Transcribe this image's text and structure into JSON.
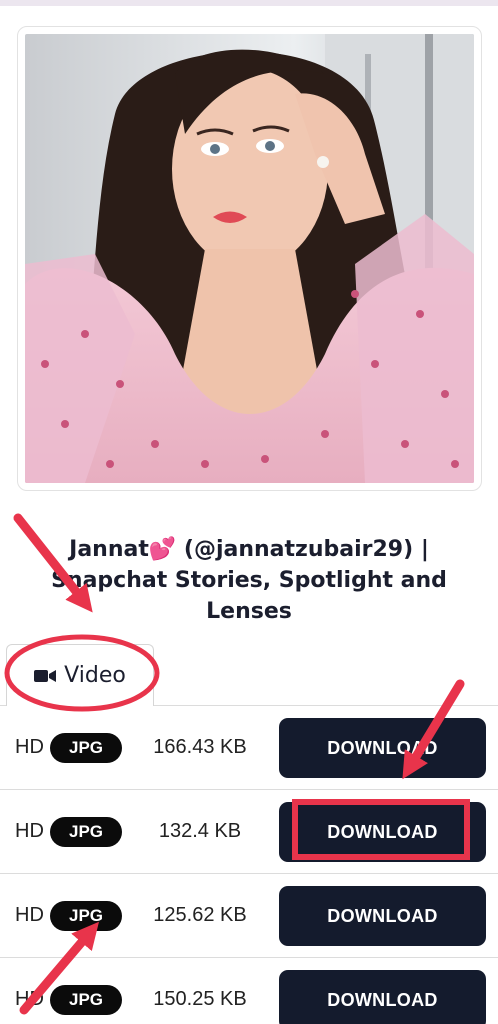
{
  "profile": {
    "title": "Jannat💕 (@jannatzubair29) | Snapchat Stories, Spotlight and Lenses",
    "photo_alt": "profile photo"
  },
  "tabs": [
    {
      "label": "Video",
      "icon": "video-camera-icon"
    }
  ],
  "downloads": [
    {
      "quality": "HD",
      "format": "JPG",
      "size": "166.43 KB",
      "button": "DOWNLOAD"
    },
    {
      "quality": "HD",
      "format": "JPG",
      "size": "132.4 KB",
      "button": "DOWNLOAD"
    },
    {
      "quality": "HD",
      "format": "JPG",
      "size": "125.62 KB",
      "button": "DOWNLOAD"
    },
    {
      "quality": "HD",
      "format": "JPG",
      "size": "150.25 KB",
      "button": "DOWNLOAD"
    }
  ],
  "colors": {
    "button_bg": "#141b2d",
    "badge_bg": "#0b0b0b",
    "annotation": "#e8344b"
  }
}
